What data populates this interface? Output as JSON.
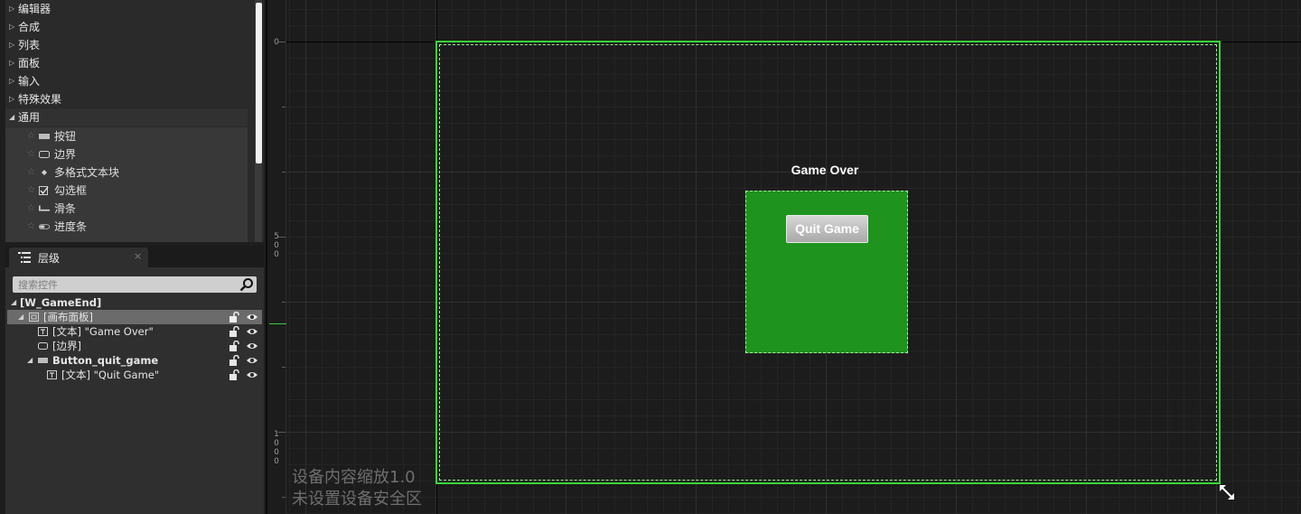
{
  "palette": {
    "categories": [
      {
        "label": "编辑器",
        "expanded": false
      },
      {
        "label": "合成",
        "expanded": false
      },
      {
        "label": "列表",
        "expanded": false
      },
      {
        "label": "面板",
        "expanded": false
      },
      {
        "label": "输入",
        "expanded": false
      },
      {
        "label": "特殊效果",
        "expanded": false
      },
      {
        "label": "通用",
        "expanded": true
      }
    ],
    "items": [
      {
        "label": "按钮",
        "icon": "button-widget-icon"
      },
      {
        "label": "边界",
        "icon": "border-widget-icon"
      },
      {
        "label": "多格式文本块",
        "icon": "rich-text-icon"
      },
      {
        "label": "勾选框",
        "icon": "checkbox-icon"
      },
      {
        "label": "滑条",
        "icon": "slider-icon"
      },
      {
        "label": "进度条",
        "icon": "progress-bar-icon"
      }
    ]
  },
  "hierarchy": {
    "tab_label": "层级",
    "tab_close": "×",
    "search_placeholder": "搜索控件",
    "tree": [
      {
        "label": "[W_GameEnd]",
        "bold": true
      },
      {
        "label": "[画布面板]",
        "selected": true
      },
      {
        "label": "[文本] \"Game Over\""
      },
      {
        "label": "[边界]"
      },
      {
        "label": "Button_quit_game",
        "bold": true
      },
      {
        "label": "[文本] \"Quit Game\""
      }
    ]
  },
  "designer": {
    "ruler_labels": [
      "0",
      "5\n0\n0",
      "1\n0\n0\n0"
    ],
    "title_text": "Game Over",
    "button_label": "Quit Game",
    "dpi_scale_text": "设备内容缩放1.0",
    "safe_zone_text": "未设置设备安全区",
    "colors": {
      "canvas_outline": "#39d439",
      "border_fill": "#1e941e",
      "grid_background": "#1c1c1c"
    }
  }
}
